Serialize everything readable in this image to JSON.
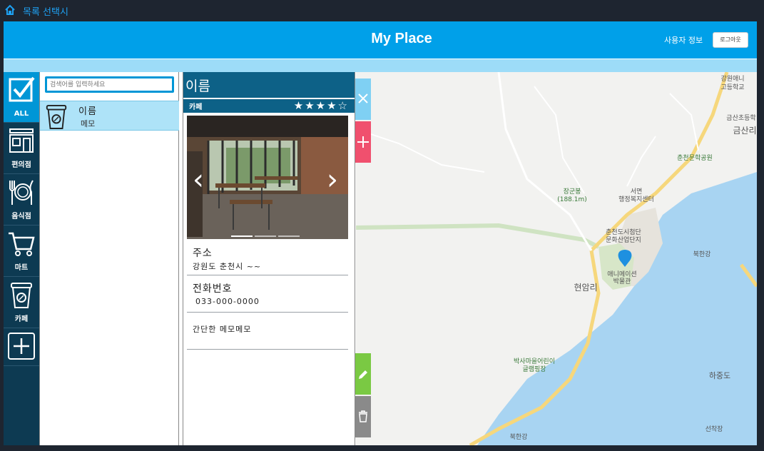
{
  "topbar": {
    "breadcrumb": "목록 선택시"
  },
  "header": {
    "title": "My Place",
    "user_info": "사용자 정보",
    "logout": "로그아웃"
  },
  "categories": [
    {
      "label": "ALL",
      "icon": "checkbox-icon",
      "active": true
    },
    {
      "label": "편의점",
      "icon": "store-icon"
    },
    {
      "label": "음식점",
      "icon": "restaurant-icon"
    },
    {
      "label": "마트",
      "icon": "cart-icon"
    },
    {
      "label": "카페",
      "icon": "coffee-cup-icon"
    },
    {
      "label": "",
      "icon": "add-category-icon"
    }
  ],
  "search": {
    "placeholder": "검색어를 입력하세요"
  },
  "list": [
    {
      "name": "이름",
      "memo": "메모",
      "icon": "coffee-cup-icon"
    }
  ],
  "detail": {
    "title": "이름",
    "category": "카페",
    "rating": 4,
    "rating_max": 5,
    "address_label": "주소",
    "address": "강원도 춘천시 ~~",
    "phone_label": "전화번호",
    "phone": "033-000-0000",
    "memo": "간단한 메모메모"
  },
  "actions": {
    "close": "close-icon",
    "add": "plus-icon",
    "edit": "pencil-icon",
    "delete": "trash-icon"
  },
  "map": {
    "labels": [
      "강원애니",
      "고등학교",
      "금산초등학",
      "금산리",
      "춘천문학공원",
      "장군봉",
      "(188.1m)",
      "서면",
      "행정복지센터",
      "춘천도시첨단",
      "문화산업단지",
      "애니메이션",
      "박물관",
      "북한강",
      "현암리",
      "박사마을어린이",
      "글램핑장",
      "하중도",
      "북한강",
      "선착장"
    ]
  },
  "colors": {
    "accent": "#00a0e9",
    "dark": "#0d3a52",
    "detail_head": "#0d6187",
    "list_selected": "#aee3f8",
    "close_btn": "#7fd0f3",
    "add_btn": "#f0506e",
    "edit_btn": "#7ac943",
    "delete_btn": "#8a8a8a"
  }
}
